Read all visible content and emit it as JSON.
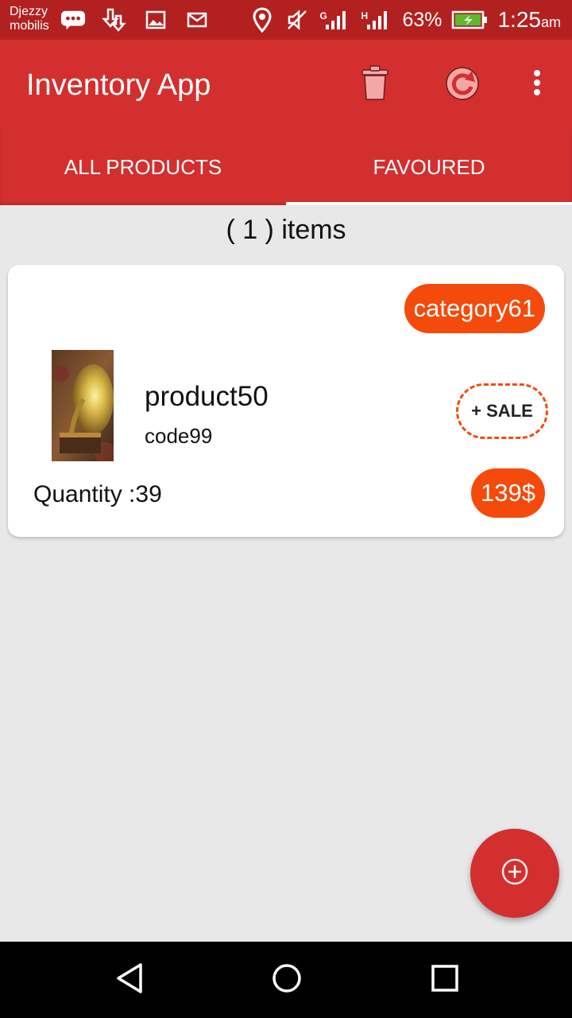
{
  "status_bar": {
    "carrier_line1": "Djezzy",
    "carrier_line2": "mobilis",
    "network_g": "G",
    "network_h": "H",
    "battery_percent": "63%",
    "time": "1:25",
    "time_suffix": "am",
    "icons": [
      "message-icon",
      "download-icon",
      "image-icon",
      "mail-icon",
      "location-icon",
      "mute-icon",
      "signal-icon",
      "signal-icon",
      "battery-icon"
    ]
  },
  "app_bar": {
    "title": "Inventory App",
    "actions": [
      "delete-icon",
      "refresh-icon",
      "more-vert-icon"
    ]
  },
  "tabs": [
    {
      "label": "ALL PRODUCTS",
      "active": false
    },
    {
      "label": "FAVOURED",
      "active": true
    }
  ],
  "list": {
    "count_label": "( 1 ) items"
  },
  "products": [
    {
      "category": "category61",
      "name": "product50",
      "code": "code99",
      "sale_label": "+ SALE",
      "quantity_label": "Quantity :39",
      "price": "139$"
    }
  ],
  "colors": {
    "primary": "#d32f2f",
    "status_bar": "#b32020",
    "accent": "#f44a0c",
    "background": "#e8e8e8"
  }
}
